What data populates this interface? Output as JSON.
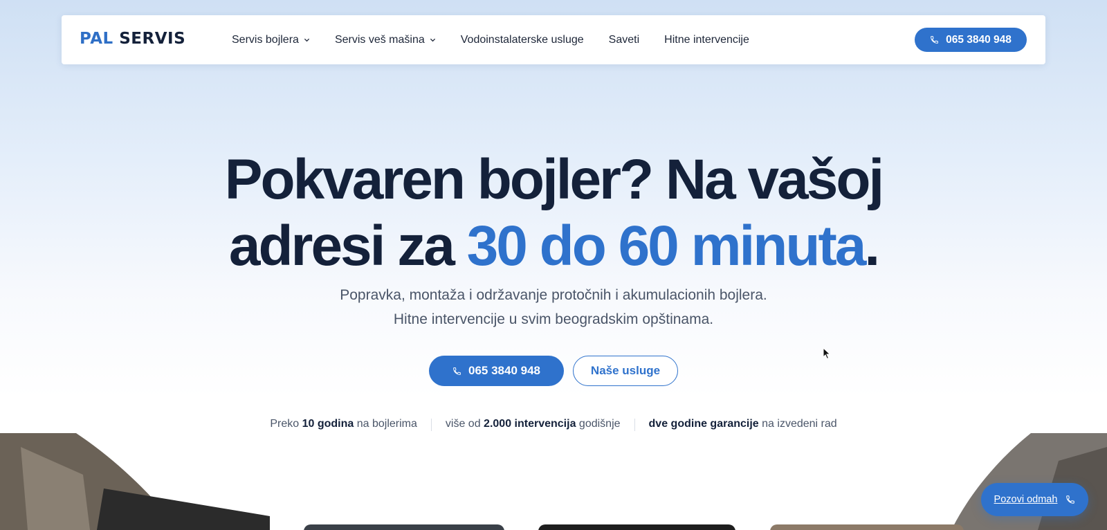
{
  "header": {
    "logo": {
      "part1": "PAL",
      "part2": "SERVIS"
    },
    "nav": [
      {
        "label": "Servis bojlera",
        "has_dropdown": true
      },
      {
        "label": "Servis veš mašina",
        "has_dropdown": true
      },
      {
        "label": "Vodoinstalaterske usluge",
        "has_dropdown": false
      },
      {
        "label": "Saveti",
        "has_dropdown": false
      },
      {
        "label": "Hitne intervencije",
        "has_dropdown": false
      }
    ],
    "phone_button": "065 3840 948"
  },
  "hero": {
    "title_line1": "Pokvaren bojler? Na vašoj",
    "title_line2_start": "adresi za",
    "title_highlight": "30 do 60 minuta",
    "title_end": ".",
    "subtitle_line1": "Popravka, montaža i održavanje protočnih i akumulacionih bojlera.",
    "subtitle_line2": "Hitne intervencije u svim beogradskim opštinama.",
    "primary_button": "065 3840 948",
    "secondary_button": "Naše usluge"
  },
  "stats": [
    {
      "pre": "Preko",
      "bold": "10 godina",
      "post": "na bojlerima"
    },
    {
      "pre": "više od",
      "bold": "2.000 intervencija",
      "post": "godišnje"
    },
    {
      "pre": "",
      "bold": "dve godine garancije",
      "post": "na izvedeni rad"
    }
  ],
  "floating_cta": {
    "label": "Pozovi odmah"
  },
  "colors": {
    "accent": "#2f72cc",
    "dark": "#14213a",
    "muted": "#4a5568"
  },
  "icons": {
    "phone": "phone-icon",
    "chevron": "chevron-down-icon"
  }
}
